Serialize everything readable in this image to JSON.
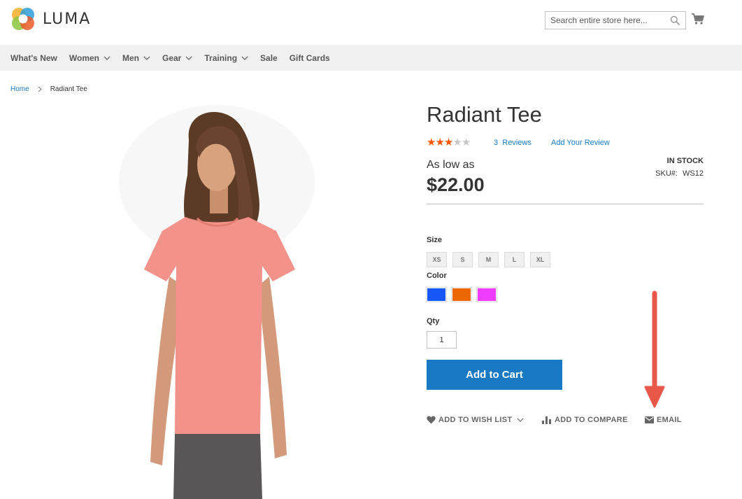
{
  "header": {
    "logo_text": "LUMA",
    "search_placeholder": "Search entire store here..."
  },
  "nav": {
    "items": [
      {
        "label": "What's New",
        "has_dropdown": false
      },
      {
        "label": "Women",
        "has_dropdown": true
      },
      {
        "label": "Men",
        "has_dropdown": true
      },
      {
        "label": "Gear",
        "has_dropdown": true
      },
      {
        "label": "Training",
        "has_dropdown": true
      },
      {
        "label": "Sale",
        "has_dropdown": false
      },
      {
        "label": "Gift Cards",
        "has_dropdown": false
      }
    ]
  },
  "breadcrumb": {
    "home": "Home",
    "current": "Radiant Tee"
  },
  "product": {
    "title": "Radiant Tee",
    "rating_stars": 3,
    "rating_max": 5,
    "reviews_count": "3",
    "reviews_label": "Reviews",
    "add_review_label": "Add Your Review",
    "price_prefix": "As low as",
    "price": "$22.00",
    "stock_status": "IN STOCK",
    "sku_label": "SKU#:",
    "sku_value": "WS12",
    "size_label": "Size",
    "sizes": [
      "XS",
      "S",
      "M",
      "L",
      "XL"
    ],
    "color_label": "Color",
    "colors": [
      "#1857f7",
      "#eb6703",
      "#ef3dff"
    ],
    "qty_label": "Qty",
    "qty_value": "1",
    "add_to_cart_label": "Add to Cart",
    "wishlist_label": "ADD TO WISH LIST",
    "compare_label": "ADD TO COMPARE",
    "email_label": "EMAIL"
  },
  "colors": {
    "accent": "#1979c3",
    "star_on": "#ff5501",
    "annotation_arrow": "#e9564a"
  }
}
